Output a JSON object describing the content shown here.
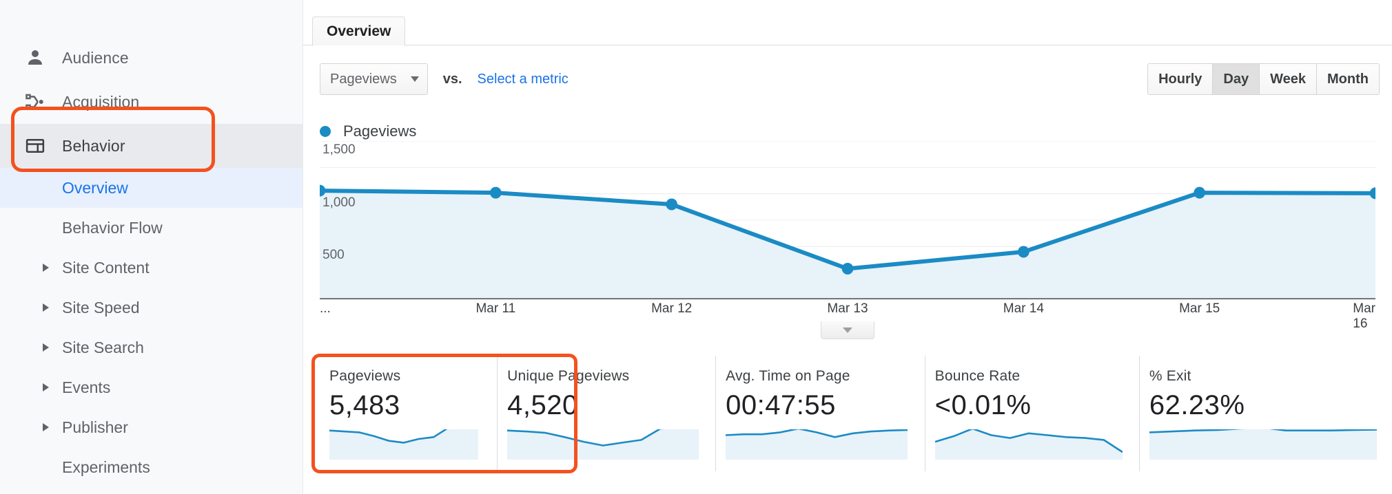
{
  "sidebar": {
    "items": [
      {
        "label": "Audience",
        "icon": "person-icon",
        "type": "top"
      },
      {
        "label": "Acquisition",
        "icon": "acquisition-icon",
        "type": "top"
      },
      {
        "label": "Behavior",
        "icon": "behavior-icon",
        "type": "top",
        "active": true
      }
    ],
    "sub_items": [
      {
        "label": "Overview",
        "selected": true,
        "expandable": false
      },
      {
        "label": "Behavior Flow",
        "selected": false,
        "expandable": false
      },
      {
        "label": "Site Content",
        "selected": false,
        "expandable": true
      },
      {
        "label": "Site Speed",
        "selected": false,
        "expandable": true
      },
      {
        "label": "Site Search",
        "selected": false,
        "expandable": true
      },
      {
        "label": "Events",
        "selected": false,
        "expandable": true
      },
      {
        "label": "Publisher",
        "selected": false,
        "expandable": true
      },
      {
        "label": "Experiments",
        "selected": false,
        "expandable": false
      }
    ]
  },
  "tabs": [
    {
      "label": "Overview",
      "active": true
    }
  ],
  "toolbar": {
    "metric_select_value": "Pageviews",
    "vs_label": "vs.",
    "select_metric_link": "Select a metric",
    "granularity": [
      {
        "label": "Hourly",
        "selected": false
      },
      {
        "label": "Day",
        "selected": true
      },
      {
        "label": "Week",
        "selected": false
      },
      {
        "label": "Month",
        "selected": false
      }
    ]
  },
  "legend": {
    "series_label": "Pageviews"
  },
  "chart_data": {
    "type": "line",
    "title": "Pageviews",
    "xlabel": "",
    "ylabel": "",
    "ylim": [
      0,
      1500
    ],
    "yticks": [
      500,
      1000,
      1500
    ],
    "ytick_labels": [
      "500",
      "1,000",
      "1,500"
    ],
    "gridlines": true,
    "legend_position": "top-left",
    "series": [
      {
        "name": "Pageviews",
        "color": "#1b8bc4",
        "fill": "#e8f2f9",
        "categories": [
          "...",
          "Mar 11",
          "Mar 12",
          "Mar 13",
          "Mar 14",
          "Mar 15",
          "Mar 16"
        ],
        "values": [
          1030,
          1010,
          900,
          290,
          450,
          1010,
          1005
        ]
      }
    ],
    "x_tick_labels": [
      "...",
      "Mar 11",
      "Mar 12",
      "Mar 13",
      "Mar 14",
      "Mar 15",
      "Mar 16"
    ]
  },
  "summary": {
    "cards": [
      {
        "title": "Pageviews",
        "value": "5,483",
        "spark": [
          62,
          60,
          58,
          50,
          40,
          36,
          44,
          48,
          68,
          70,
          70
        ],
        "highlighted": true
      },
      {
        "title": "Unique Pageviews",
        "value": "4,520",
        "spark": [
          62,
          60,
          57,
          48,
          38,
          30,
          36,
          42,
          66,
          68,
          68
        ],
        "highlighted": true
      },
      {
        "title": "Avg. Time on Page",
        "value": "00:47:55",
        "spark": [
          52,
          54,
          54,
          58,
          66,
          58,
          48,
          56,
          60,
          62,
          63
        ],
        "highlighted": false
      },
      {
        "title": "Bounce Rate",
        "value": "<0.01%",
        "spark": [
          38,
          50,
          66,
          52,
          46,
          56,
          52,
          48,
          46,
          42,
          16
        ],
        "highlighted": false
      },
      {
        "title": "% Exit",
        "value": "62.23%",
        "spark": [
          58,
          60,
          62,
          63,
          66,
          68,
          62,
          62,
          62,
          63,
          64
        ],
        "highlighted": false
      }
    ]
  },
  "icons": {
    "collapse_chart": "chevron-down-icon",
    "metric_dropdown": "chevron-down-icon"
  },
  "colors": {
    "accent_blue": "#1a73e8",
    "series_blue": "#1b8bc4",
    "highlight_orange": "#f4511e",
    "sidebar_bg": "#f8f9fa",
    "selected_sub_bg": "#e8f0fe"
  }
}
